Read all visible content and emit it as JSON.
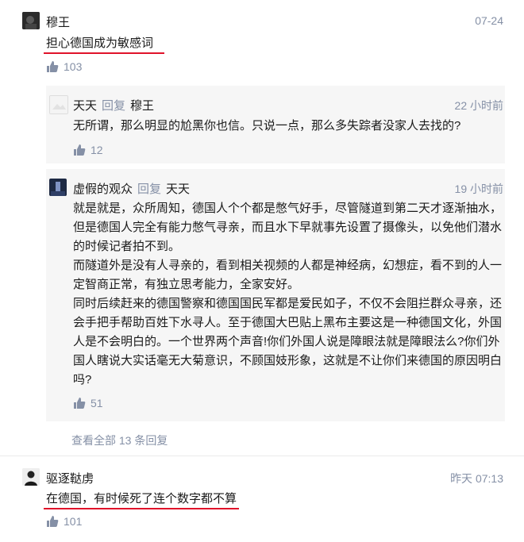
{
  "comments": [
    {
      "author": "穆王",
      "time": "07-24",
      "text": "担心德国成为敏感词",
      "likes": "103"
    },
    {
      "author": "驱逐鞑虏",
      "time": "昨天 07:13",
      "text": "在德国，有时候死了连个数字都不算",
      "likes": "101"
    }
  ],
  "replies": [
    {
      "author": "天天",
      "reply_word": "回复",
      "reply_to": "穆王",
      "time": "22 小时前",
      "text": "无所谓，那么明显的尬黑你也信。只说一点，那么多失踪者没家人去找的?",
      "likes": "12"
    },
    {
      "author": "虚假的观众",
      "reply_word": "回复",
      "reply_to": "天天",
      "time": "19 小时前",
      "lines": [
        "就是就是，众所周知，德国人个个都是憋气好手，尽管隧道到第二天才逐渐抽水，",
        "但是德国人完全有能力憋气寻亲，而且水下早就事先设置了摄像头，以免他们潜水",
        "的时候记者拍不到。",
        "而隧道外是没有人寻亲的，看到相关视频的人都是神经病，幻想症，看不到的人一",
        "定智商正常，有独立思考能力，全家安好。",
        "同时后续赶来的德国警察和德国国民军都是爱民如子，不仅不会阻拦群众寻亲，还",
        "会手把手帮助百姓下水寻人。至于德国大巴贴上黑布主要这是一种德国文化，外国",
        "人是不会明白的。一个世界两个声音!你们外国人说是障眼法就是障眼法么?你们外",
        "国人瞎说大实话毫无大菊意识，不顾国妓形象，这就是不让你们来德国的原因明白",
        "吗?"
      ],
      "likes": "51"
    }
  ],
  "view_all": "查看全部 13 条回复",
  "colors": {
    "accent_underline": "#e0132a",
    "muted": "#8590a6",
    "sub_bg": "#f6f6f6"
  },
  "icons": {
    "like": "thumbs-up-icon"
  }
}
